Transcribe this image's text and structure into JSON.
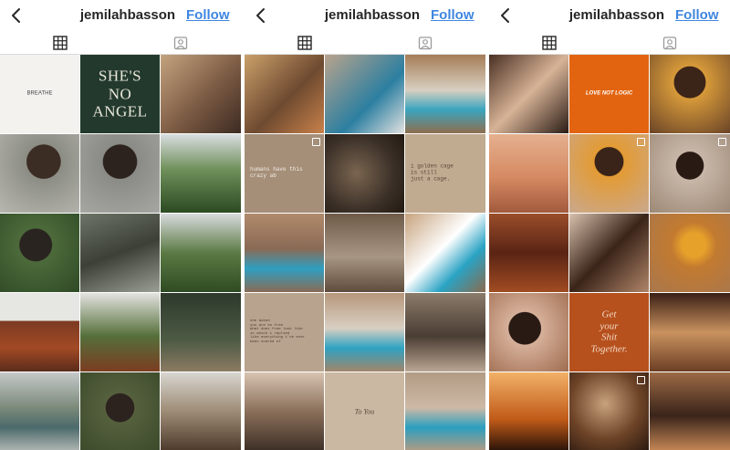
{
  "panels": [
    {
      "username": "jemilahbasson",
      "follow_label": "Follow",
      "tiles": [
        {
          "bg": "#f3f2ef",
          "text": "BREATHE",
          "text_color": "#444444",
          "font": "sans",
          "size": 6
        },
        {
          "bg": "#23392d",
          "text": "SHE'S\nNO\nANGEL",
          "text_color": "#e9e6da",
          "font": "serif",
          "size": 17
        },
        {
          "bg": "linear-gradient(135deg,#c4a37f,#7b5a43 55%,#3c2b22)"
        },
        {
          "bg": "radial-gradient(circle at 55% 35%,#3b2c24 25%,#8c8d84 26%,#b7b7b0)"
        },
        {
          "bg": "radial-gradient(circle at 50% 35%,#2c221e 26%,#8a8b86 27%,#a6a7a2)"
        },
        {
          "bg": "linear-gradient(180deg,#d9dde0,#6f8f5a 45%,#2c4a22)"
        },
        {
          "bg": "radial-gradient(circle at 45% 40%,#2a2420 25%,#4c6a3a 26%,#2f4a26)"
        },
        {
          "bg": "linear-gradient(160deg,#6d7468,#3c4036 50%,#9a9f96)"
        },
        {
          "bg": "linear-gradient(180deg,#d8dbdd,#5b7a44 50%,#2e4b22)"
        },
        {
          "bg": "linear-gradient(180deg,#e6e6e2 35%,#7b3a22 36%,#a24a25 70%,#5a2c1a)"
        },
        {
          "bg": "linear-gradient(180deg,#e3e3e0,#556f3a 55%,#7b3d22)"
        },
        {
          "bg": "linear-gradient(180deg,#2d3a2c,#4d5a44 60%,#8b7b62)"
        },
        {
          "bg": "linear-gradient(180deg,#c5c9c9,#7b8a7a 45%,#4b6a6b 70%,#b0b6b2)"
        },
        {
          "bg": "radial-gradient(circle at 50% 45%,#2c221e 24%,#55603d 25%,#3c4a2b)"
        },
        {
          "bg": "linear-gradient(180deg,#d8d6d0,#9d8b75 50%,#4d3a2c)"
        }
      ]
    },
    {
      "username": "jemilahbasson",
      "follow_label": "Follow",
      "tiles": [
        {
          "bg": "linear-gradient(135deg,#caa06a,#6e4a30 55%,#c9814a)"
        },
        {
          "bg": "linear-gradient(135deg,#b9a38c,#2c7fa1 60%,#e2e2e0)"
        },
        {
          "bg": "linear-gradient(180deg,#a57d57,#d8cfc1 45%,#3aa5bf 70%,#8f6d4d)"
        },
        {
          "bg": "#a58f79",
          "text": "humans have this crazy ab",
          "text_color": "#f3ede6",
          "font": "mono",
          "size": 6,
          "multi": true
        },
        {
          "bg": "radial-gradient(circle at 40% 50%,#7a6550,#3b3028 60%,#21190f)"
        },
        {
          "bg": "#c0aa90",
          "text": "i golden cage\nis still\njust a cage.",
          "text_color": "#5a4a3d",
          "font": "mono",
          "size": 6
        },
        {
          "bg": "linear-gradient(180deg,#b18a6b,#8a6a55 45%,#2f9fc0 70%,#8a6a55)"
        },
        {
          "bg": "linear-gradient(180deg,#6f5a48,#a89684 55%,#5f4c3c)"
        },
        {
          "bg": "linear-gradient(135deg,#c7a37e,#ffffff 45%,#2aa3c4 70%,#8b6a4d)"
        },
        {
          "bg": "#b8a38e",
          "text": "she asked\nyou are so free\nwhat does free look like\nin which i replied\nlike everything i've ever\nbeen scared of",
          "text_color": "#4a3b2f",
          "font": "mono",
          "size": 4
        },
        {
          "bg": "linear-gradient(180deg,#b6977a,#d9cfc3 45%,#2ea2c1 70%,#a2856a)"
        },
        {
          "bg": "linear-gradient(180deg,#8b7b6b,#4a3d33 55%,#b9a592)"
        },
        {
          "bg": "linear-gradient(180deg,#d7c4b1,#8a6f5a 50%,#3e2f26)"
        },
        {
          "bg": "#cbb8a2",
          "text": "To You",
          "text_color": "#5b4636",
          "font": "serif-italic",
          "size": 8
        },
        {
          "bg": "linear-gradient(180deg,#b29b84,#cdb9a6 45%,#2b9fbf 70%,#b29b84)"
        }
      ]
    },
    {
      "username": "jemilahbasson",
      "follow_label": "Follow",
      "tiles": [
        {
          "bg": "linear-gradient(135deg,#4a3024,#d7b396 50%,#2a1c16)"
        },
        {
          "bg": "#e26410",
          "text": "LOVE NOT LOGIC",
          "text_color": "#ffffff",
          "font": "sans-bold-italic",
          "size": 6
        },
        {
          "bg": "radial-gradient(circle at 50% 35%,#3b2418 24%,#d79a3a 25%,#6a4427)"
        },
        {
          "bg": "linear-gradient(180deg,#e5b08f,#d58a62 55%,#a25a3d)"
        },
        {
          "bg": "radial-gradient(circle at 50% 35%,#3a2419 22%,#e39b34 23%,#caa88e)",
          "multi": true
        },
        {
          "bg": "radial-gradient(circle at 50% 40%,#2a1a14 22%,#c8b7a8 23%,#9c8876)",
          "multi": true
        },
        {
          "bg": "linear-gradient(180deg,#9a4d2a,#5a2414 50%,#a14c22)"
        },
        {
          "bg": "linear-gradient(135deg,#d8c1ad,#3a2419 50%,#b08568)"
        },
        {
          "bg": "radial-gradient(circle at 55% 40%,#e6a12a 18%,#c27a30 35%,#a8774e)"
        },
        {
          "bg": "radial-gradient(circle at 45% 45%,#2a1a14 26%,#d6b09a 27%,#9f6c4f)"
        },
        {
          "bg": "#b6501d",
          "text": "Get\nyour\nShit\nTogether.",
          "text_color": "#f2d8c3",
          "font": "serif-italic",
          "size": 11
        },
        {
          "bg": "linear-gradient(180deg,#3a2016,#c9925f 50%,#6c3e24)"
        },
        {
          "bg": "linear-gradient(180deg,#f2b168,#c05a18 60%,#2a1308)"
        },
        {
          "bg": "radial-gradient(circle at 45% 40%,#c8a27d,#6d4327 55%,#2b190f)",
          "multi": true
        },
        {
          "bg": "linear-gradient(180deg,#9c6a45,#3a241a 55%,#c68856)"
        }
      ]
    }
  ]
}
